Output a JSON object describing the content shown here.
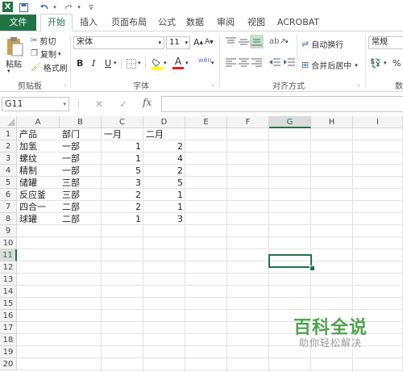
{
  "title_bar": {
    "logo_text": "X"
  },
  "tabs": [
    {
      "label": "文件"
    },
    {
      "label": "开始"
    },
    {
      "label": "插入"
    },
    {
      "label": "页面布局"
    },
    {
      "label": "公式"
    },
    {
      "label": "数据"
    },
    {
      "label": "审阅"
    },
    {
      "label": "视图"
    },
    {
      "label": "ACROBAT"
    }
  ],
  "ribbon": {
    "clipboard": {
      "paste": "粘贴",
      "cut": "剪切",
      "copy": "复制",
      "format_painter": "格式刷",
      "group_label": "剪贴板"
    },
    "font": {
      "font_name": "宋体",
      "font_size": "11",
      "bold": "B",
      "italic": "I",
      "underline": "U",
      "grow": "A",
      "shrink": "A",
      "phonetic": "wén",
      "group_label": "字体"
    },
    "alignment": {
      "wrap_text": "自动换行",
      "merge_center": "合并后居中",
      "group_label": "对齐方式"
    },
    "number": {
      "format": "常规",
      "percent": "%",
      "group_label": "数"
    }
  },
  "formula_bar": {
    "name_box": "G11",
    "fx": "fx",
    "cancel": "✕",
    "confirm": "✓",
    "formula": ""
  },
  "columns": [
    "A",
    "B",
    "C",
    "D",
    "E",
    "F",
    "G",
    "H",
    "I"
  ],
  "selected_column": "G",
  "row_numbers": [
    "1",
    "2",
    "3",
    "4",
    "5",
    "6",
    "7",
    "8",
    "9",
    "10",
    "11",
    "12",
    "13",
    "14",
    "15",
    "16",
    "17",
    "18",
    "19",
    "20"
  ],
  "selected_row": "11",
  "sheet": {
    "header": [
      "产品",
      "部门",
      "一月",
      "二月"
    ],
    "rows": [
      [
        "加氢",
        "一部",
        "1",
        "2"
      ],
      [
        "螺纹",
        "一部",
        "1",
        "4"
      ],
      [
        "精制",
        "一部",
        "5",
        "2"
      ],
      [
        "储罐",
        "三部",
        "3",
        "5"
      ],
      [
        "反应釜",
        "三部",
        "2",
        "1"
      ],
      [
        "四合一",
        "二部",
        "2",
        "1"
      ],
      [
        "球罐",
        "二部",
        "1",
        "3"
      ]
    ]
  },
  "watermark": {
    "title": "百科全说",
    "subtitle": "助你轻松解决"
  }
}
